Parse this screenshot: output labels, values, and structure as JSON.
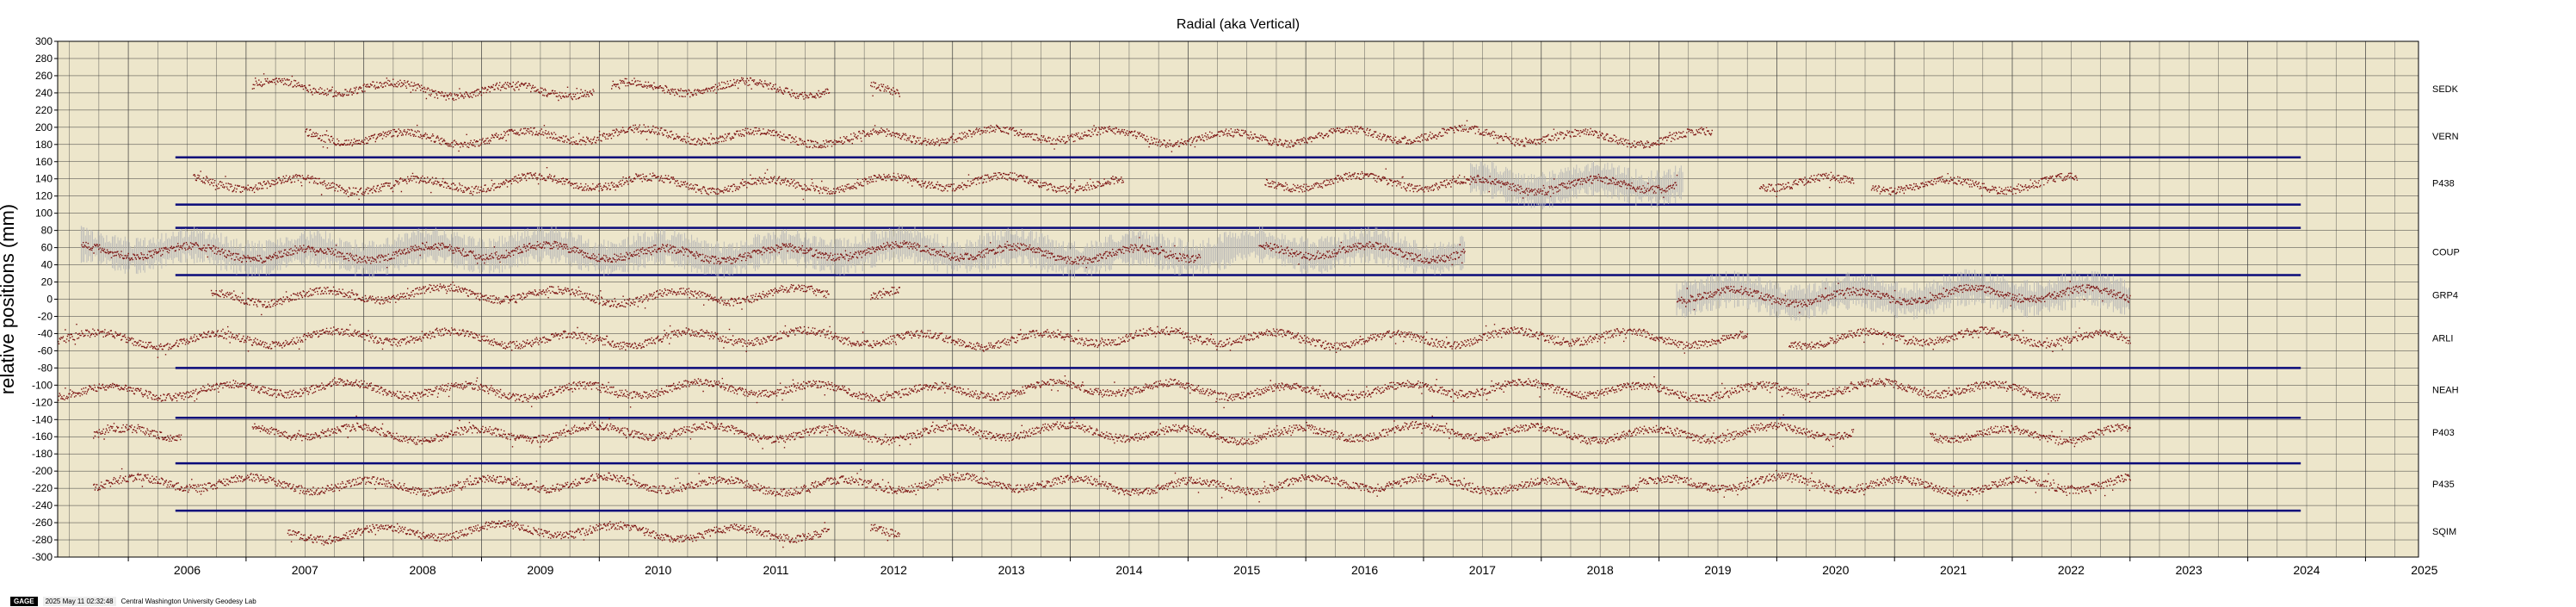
{
  "chart_data": {
    "type": "scatter",
    "title": "Radial (aka Vertical)",
    "ylabel": "relative positions (mm)",
    "xlabel": "",
    "xlim": [
      2005.4,
      2025.45
    ],
    "ylim": [
      -300,
      300
    ],
    "y_tick_step": 20,
    "x_ticks": [
      "2006",
      "2007",
      "2008",
      "2009",
      "2010",
      "2011",
      "2012",
      "2013",
      "2014",
      "2015",
      "2016",
      "2017",
      "2018",
      "2019",
      "2020",
      "2021",
      "2022",
      "2023",
      "2024",
      "2025"
    ],
    "grid": true,
    "background_color": "#ede6cb",
    "point_color": "#7a0f0f",
    "error_color": "#b7b7b7",
    "line_color": "#0a0a7a",
    "series": [
      {
        "name": "SEDK",
        "offset": 245,
        "segments": [
          [
            2007.05,
            2009.95
          ],
          [
            2010.1,
            2011.95
          ],
          [
            2012.3,
            2012.55
          ]
        ],
        "errors": false
      },
      {
        "name": "VERN",
        "offset": 190,
        "segments": [
          [
            2007.5,
            2019.45
          ]
        ],
        "errors": false
      },
      {
        "name": "P438",
        "offset": 135,
        "segments": [
          [
            2006.55,
            2014.45
          ],
          [
            2015.65,
            2019.15
          ],
          [
            2019.85,
            2020.65
          ],
          [
            2020.8,
            2022.55
          ]
        ],
        "errors": true,
        "error_span": [
          2017.4,
          2019.2
        ]
      },
      {
        "name": "COUP",
        "offset": 55,
        "segments": [
          [
            2005.6,
            2011.3
          ],
          [
            2011.3,
            2015.1
          ],
          [
            2015.6,
            2017.35
          ]
        ],
        "errors": true,
        "error_span": [
          2005.6,
          2017.35
        ]
      },
      {
        "name": "GRP4",
        "offset": 5,
        "segments": [
          [
            2006.7,
            2011.95
          ],
          [
            2012.3,
            2012.55
          ],
          [
            2019.15,
            2023.0
          ]
        ],
        "errors": true,
        "error_span": [
          2019.15,
          2023.0
        ]
      },
      {
        "name": "ARLI",
        "offset": -45,
        "segments": [
          [
            2005.4,
            2019.75
          ],
          [
            2020.1,
            2023.0
          ]
        ],
        "errors": false
      },
      {
        "name": "NEAH",
        "offset": -105,
        "segments": [
          [
            2005.4,
            2022.4
          ]
        ],
        "errors": false
      },
      {
        "name": "P403",
        "offset": -155,
        "segments": [
          [
            2005.7,
            2006.45
          ],
          [
            2007.05,
            2020.65
          ],
          [
            2021.3,
            2023.0
          ]
        ],
        "errors": false
      },
      {
        "name": "P435",
        "offset": -215,
        "segments": [
          [
            2005.7,
            2023.0
          ]
        ],
        "errors": false
      },
      {
        "name": "SQIM",
        "offset": -270,
        "segments": [
          [
            2007.35,
            2011.95
          ],
          [
            2012.3,
            2012.55
          ]
        ],
        "errors": false
      }
    ],
    "reference_lines": [
      {
        "y": 165,
        "x": [
          2006.4,
          2024.45
        ]
      },
      {
        "y": 110,
        "x": [
          2006.4,
          2024.45
        ]
      },
      {
        "y": 83,
        "x": [
          2006.4,
          2024.45
        ]
      },
      {
        "y": 28,
        "x": [
          2006.4,
          2024.45
        ]
      },
      {
        "y": -80,
        "x": [
          2006.4,
          2024.45
        ]
      },
      {
        "y": -138,
        "x": [
          2006.4,
          2024.45
        ]
      },
      {
        "y": -191,
        "x": [
          2006.4,
          2024.45
        ]
      },
      {
        "y": -246,
        "x": [
          2006.4,
          2024.45
        ]
      }
    ]
  },
  "footer": {
    "logo": "GAGE",
    "timestamp": "2025 May 11 02:32:48",
    "credit": "Central Washington University Geodesy Lab"
  }
}
